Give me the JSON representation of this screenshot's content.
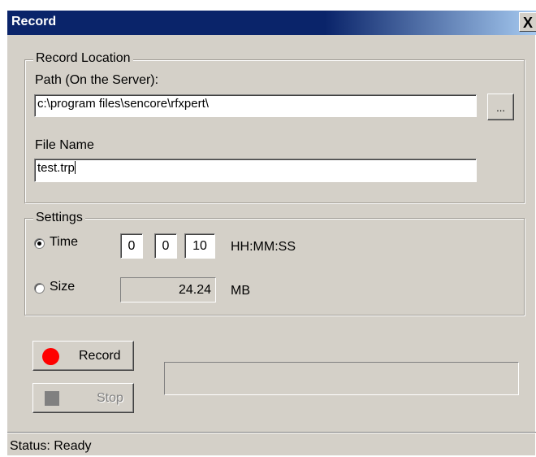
{
  "window": {
    "title": "Record",
    "close_glyph": "X"
  },
  "location": {
    "legend": "Record Location",
    "path_label": "Path  (On the Server):",
    "path_value": "c:\\program files\\sencore\\rfxpert\\",
    "browse_label": "...",
    "filename_label": "File Name",
    "filename_value": "test.trp"
  },
  "settings": {
    "legend": "Settings",
    "time_label": "Time",
    "time_selected": true,
    "hours": "0",
    "minutes": "0",
    "seconds": "10",
    "time_format": "HH:MM:SS",
    "size_label": "Size",
    "size_selected": false,
    "size_value": "24.24",
    "size_unit": "MB"
  },
  "actions": {
    "record_label": "Record",
    "record_icon": "red-circle-icon",
    "record_color": "#ff0000",
    "stop_label": "Stop",
    "stop_icon": "square-stop-icon",
    "stop_color": "#808080",
    "progress": 0
  },
  "status": {
    "text": "Status: Ready"
  }
}
